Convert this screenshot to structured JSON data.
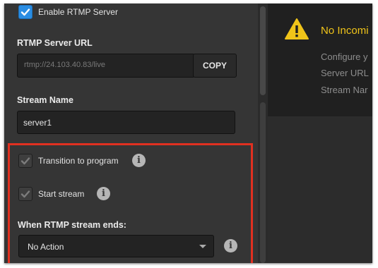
{
  "rtmp": {
    "enable_label": "Enable RTMP Server",
    "server_url_title": "RTMP Server URL",
    "server_url_value": "rtmp://24.103.40.83/live",
    "copy_label": "COPY",
    "stream_name_title": "Stream Name",
    "stream_name_value": "server1",
    "transition_label": "Transition to program",
    "start_stream_label": "Start stream",
    "ends_title": "When RTMP stream ends:",
    "ends_value": "No Action",
    "info_glyph": "i"
  },
  "notice": {
    "title": "No Incomi",
    "lines": [
      "Configure y",
      "Server URL",
      "Stream Nar"
    ]
  },
  "state": {
    "enable_checked": true,
    "transition_checked": true,
    "start_stream_checked": true
  },
  "colors": {
    "accent_blue": "#2a8de3",
    "warning_yellow": "#f0c419",
    "highlight_red": "#e03020"
  },
  "icons": [
    "checkmark-icon",
    "info-icon",
    "warning-icon",
    "chevron-down-icon"
  ]
}
